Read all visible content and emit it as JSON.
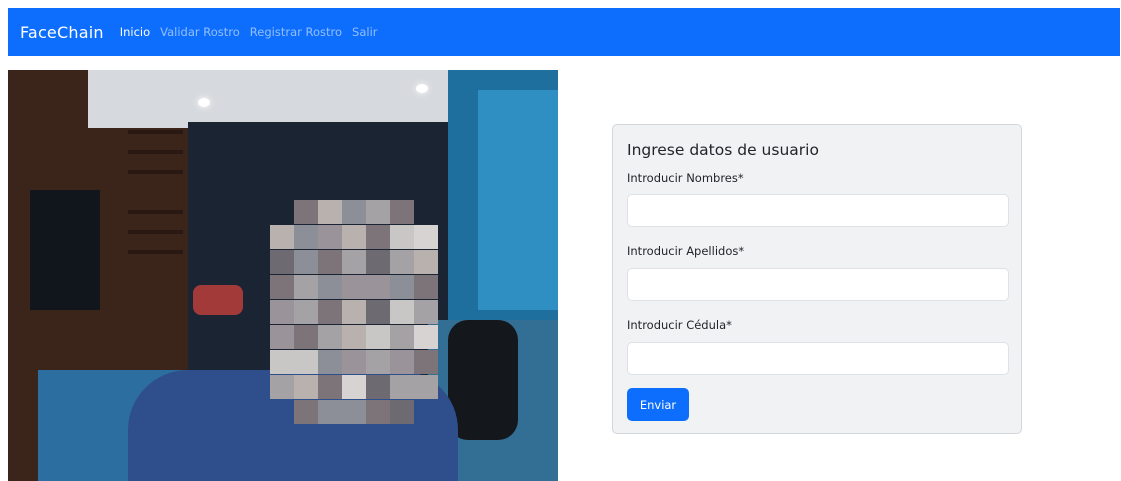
{
  "navbar": {
    "brand": "FaceChain",
    "links": [
      {
        "label": "Inicio"
      },
      {
        "label": "Validar Rostro"
      },
      {
        "label": "Registrar Rostro"
      },
      {
        "label": "Salir"
      }
    ],
    "active_link": "Inicio",
    "background_color": "#0d6efd"
  },
  "camera_feed": {
    "content": "webcam view of a person with pixelated face"
  },
  "form": {
    "title": "Ingrese datos de usuario",
    "fields": [
      {
        "label": "Introducir Nombres*",
        "value": "",
        "placeholder": ""
      },
      {
        "label": "Introducir Apellidos*",
        "value": "",
        "placeholder": ""
      },
      {
        "label": "Introducir Cédula*",
        "value": "",
        "placeholder": ""
      }
    ],
    "submit_label": "Enviar",
    "accent_color": "#0d6efd"
  }
}
